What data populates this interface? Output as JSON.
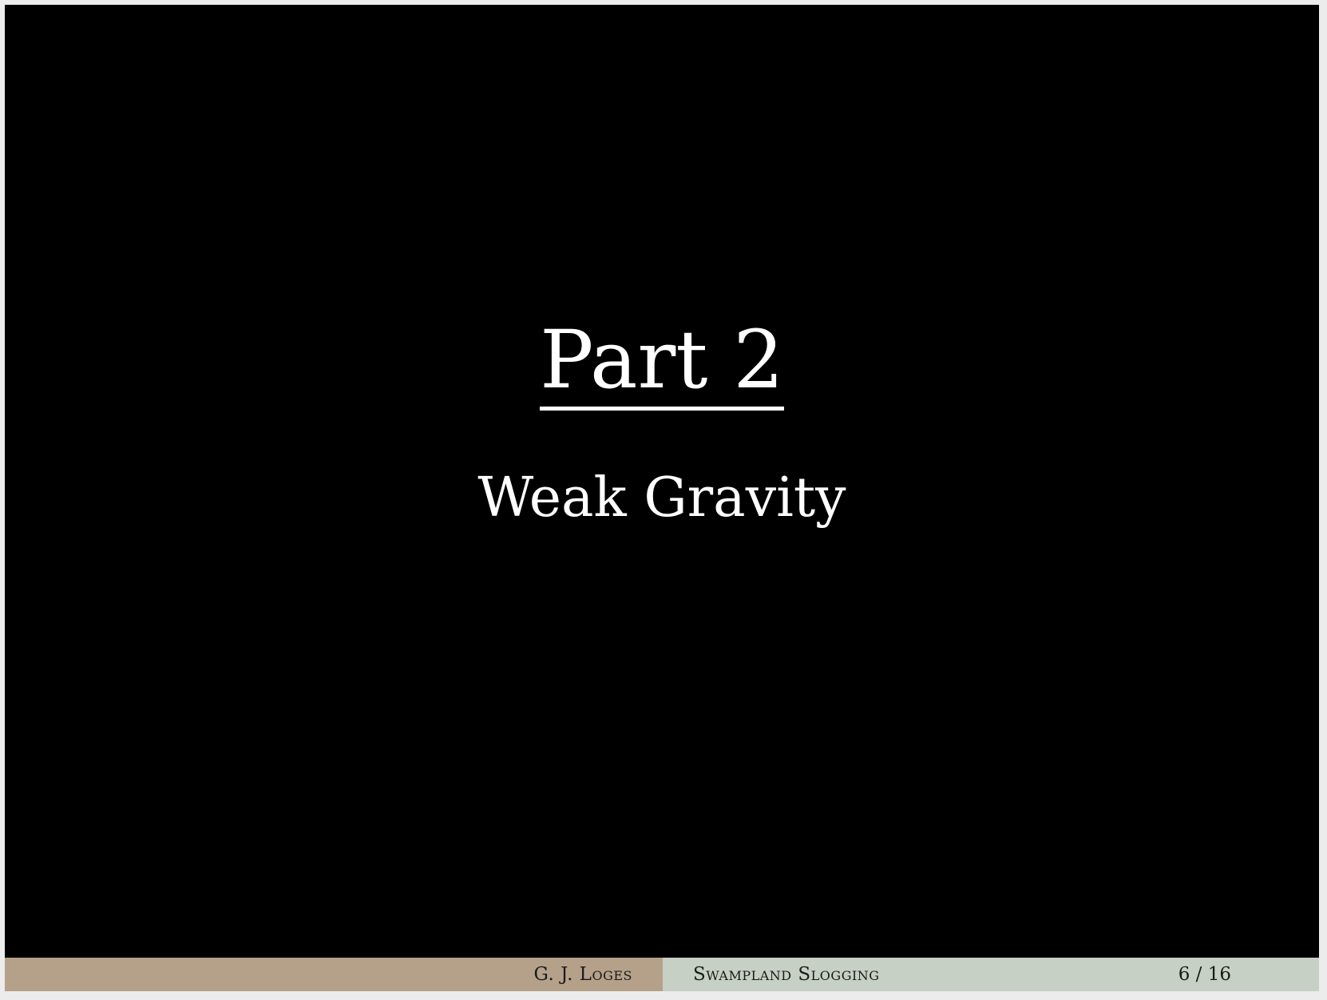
{
  "slide": {
    "part_label": "Part 2",
    "subtitle": "Weak Gravity"
  },
  "footer": {
    "author": "G. J. Loges",
    "talk_title": "Swampland Slogging",
    "page_counter": "6 / 16"
  },
  "colors": {
    "slide_background": "#000000",
    "text": "#ffffff",
    "footer_author_bg": "#b5a18a",
    "footer_title_bg": "#c6d0c4"
  }
}
